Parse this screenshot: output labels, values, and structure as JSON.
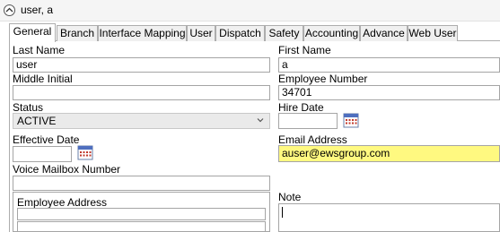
{
  "window": {
    "title": "user, a"
  },
  "tabs": [
    {
      "label": "General",
      "active": true
    },
    {
      "label": "Branch"
    },
    {
      "label": "Interface Mapping"
    },
    {
      "label": "User"
    },
    {
      "label": "Dispatch"
    },
    {
      "label": "Safety"
    },
    {
      "label": "Accounting"
    },
    {
      "label": "Advance"
    },
    {
      "label": "Web User"
    }
  ],
  "form": {
    "last_name_label": "Last Name",
    "last_name_value": "user",
    "first_name_label": "First Name",
    "first_name_value": "a",
    "middle_initial_label": "Middle Initial",
    "middle_initial_value": "",
    "employee_number_label": "Employee Number",
    "employee_number_value": "34701",
    "status_label": "Status",
    "status_value": "ACTIVE",
    "hire_date_label": "Hire Date",
    "hire_date_value": "",
    "effective_date_label": "Effective Date",
    "effective_date_value": "",
    "email_label": "Email Address",
    "email_value": "auser@ewsgroup.com",
    "voice_mailbox_label": "Voice Mailbox Number",
    "voice_mailbox_value": "",
    "employee_address_label": "Employee Address",
    "note_label": "Note",
    "note_value": ""
  },
  "colors": {
    "email_highlight": "#fff980"
  }
}
